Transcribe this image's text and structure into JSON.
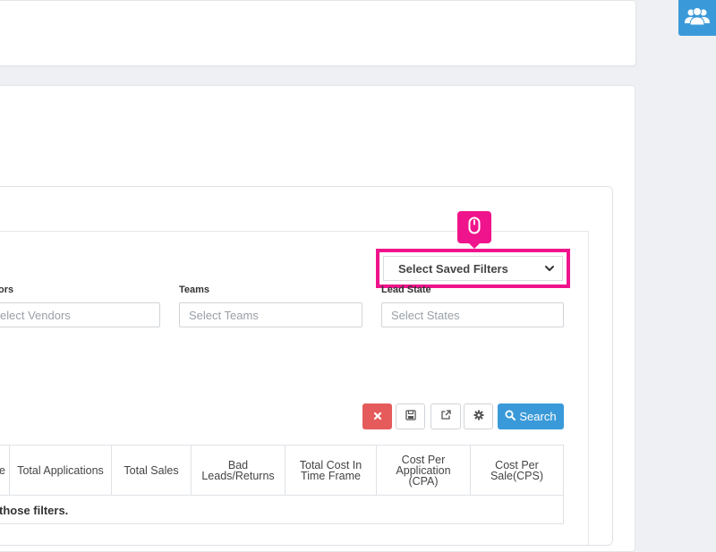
{
  "filters": {
    "saved_filters_label": "Select Saved Filters",
    "vendors": {
      "label": "ors",
      "placeholder": "elect Vendors"
    },
    "teams": {
      "label": "Teams",
      "placeholder": "Select Teams"
    },
    "lead_state": {
      "label": "Lead State",
      "placeholder": "Select States"
    }
  },
  "toolbar": {
    "search_label": "Search"
  },
  "table": {
    "headers": [
      "e",
      "Total Applications",
      "Total Sales",
      "Bad Leads/Returns",
      "Total Cost In Time Frame",
      "Cost Per Application (CPA)",
      "Cost Per Sale(CPS)"
    ],
    "empty_message": "those filters."
  },
  "colors": {
    "accent": "#3a9ad9",
    "danger": "#e55b5b",
    "highlight": "#f0148c"
  },
  "icons": [
    "users-icon",
    "mouse-icon",
    "chevron-down-icon",
    "close-icon",
    "save-icon",
    "external-link-icon",
    "gear-icon",
    "search-icon"
  ]
}
